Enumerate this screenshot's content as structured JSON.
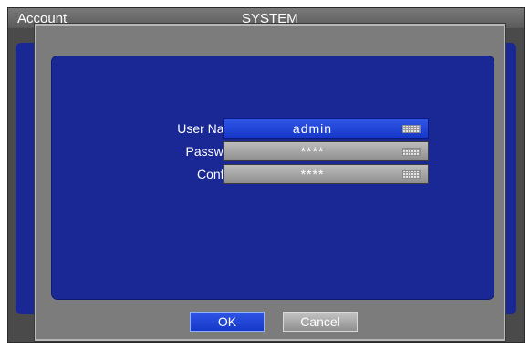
{
  "window": {
    "left_title": "Account",
    "center_title": "SYSTEM"
  },
  "form": {
    "fields": [
      {
        "label": "User Name",
        "value": "admin",
        "icon": "keyboard-icon"
      },
      {
        "label": "Password",
        "value": "****",
        "icon": "keyboard-icon"
      },
      {
        "label": "Confirm",
        "value": "****",
        "icon": "keyboard-icon"
      }
    ]
  },
  "buttons": {
    "ok_label": "OK",
    "cancel_label": "Cancel"
  },
  "colors": {
    "panel_blue": "#1a2896",
    "active_blue": "#1f45d8",
    "frame_gray": "#7c7c7c"
  }
}
